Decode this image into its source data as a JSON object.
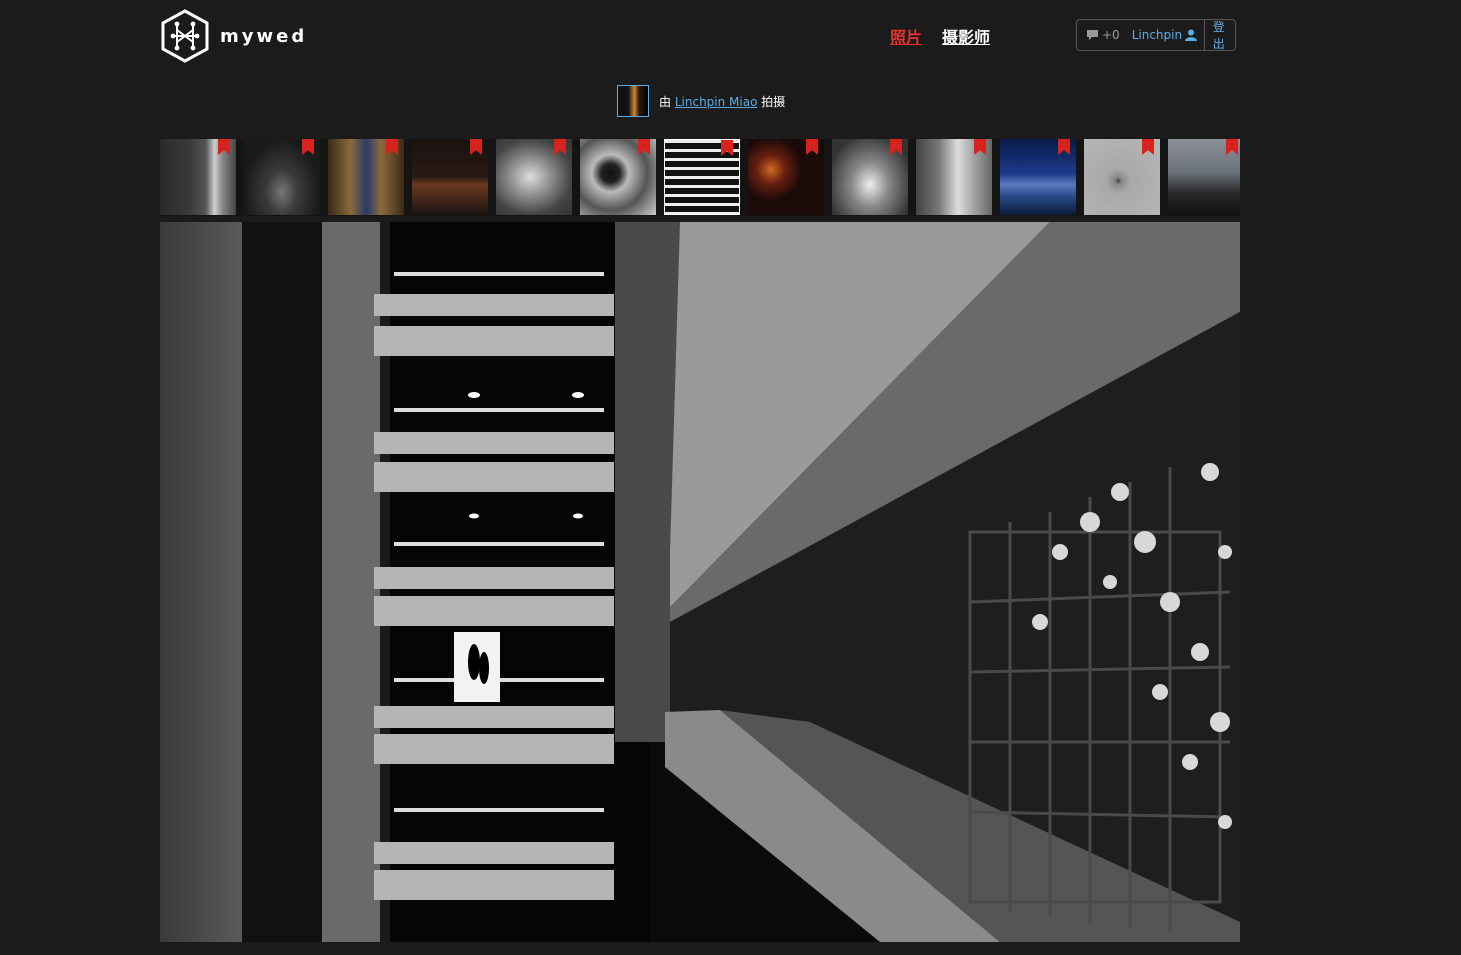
{
  "header": {
    "logo_text": "mywed",
    "nav": [
      {
        "label": "照片",
        "active": true
      },
      {
        "label": "摄影师",
        "active": false
      }
    ],
    "user": {
      "message_count": "+0",
      "username": "Linchpin",
      "logout_label": "登出"
    }
  },
  "byline": {
    "prefix": "由",
    "photographer": "Linchpin Miao",
    "suffix": "拍摄"
  },
  "thumbnails": [
    {
      "id": 1,
      "selected": false
    },
    {
      "id": 2,
      "selected": false
    },
    {
      "id": 3,
      "selected": false
    },
    {
      "id": 4,
      "selected": false
    },
    {
      "id": 5,
      "selected": false
    },
    {
      "id": 6,
      "selected": false
    },
    {
      "id": 7,
      "selected": true
    },
    {
      "id": 8,
      "selected": false
    },
    {
      "id": 9,
      "selected": false
    },
    {
      "id": 10,
      "selected": false
    },
    {
      "id": 11,
      "selected": false
    },
    {
      "id": 12,
      "selected": false
    },
    {
      "id": 13,
      "selected": false
    }
  ],
  "colors": {
    "accent_red": "#e4332c",
    "link_blue": "#5aaee6",
    "background": "#1b1b1b",
    "bookmark_red": "#d8221e"
  },
  "icons": [
    "logo-icon",
    "message-icon",
    "user-icon",
    "bookmark-icon"
  ]
}
